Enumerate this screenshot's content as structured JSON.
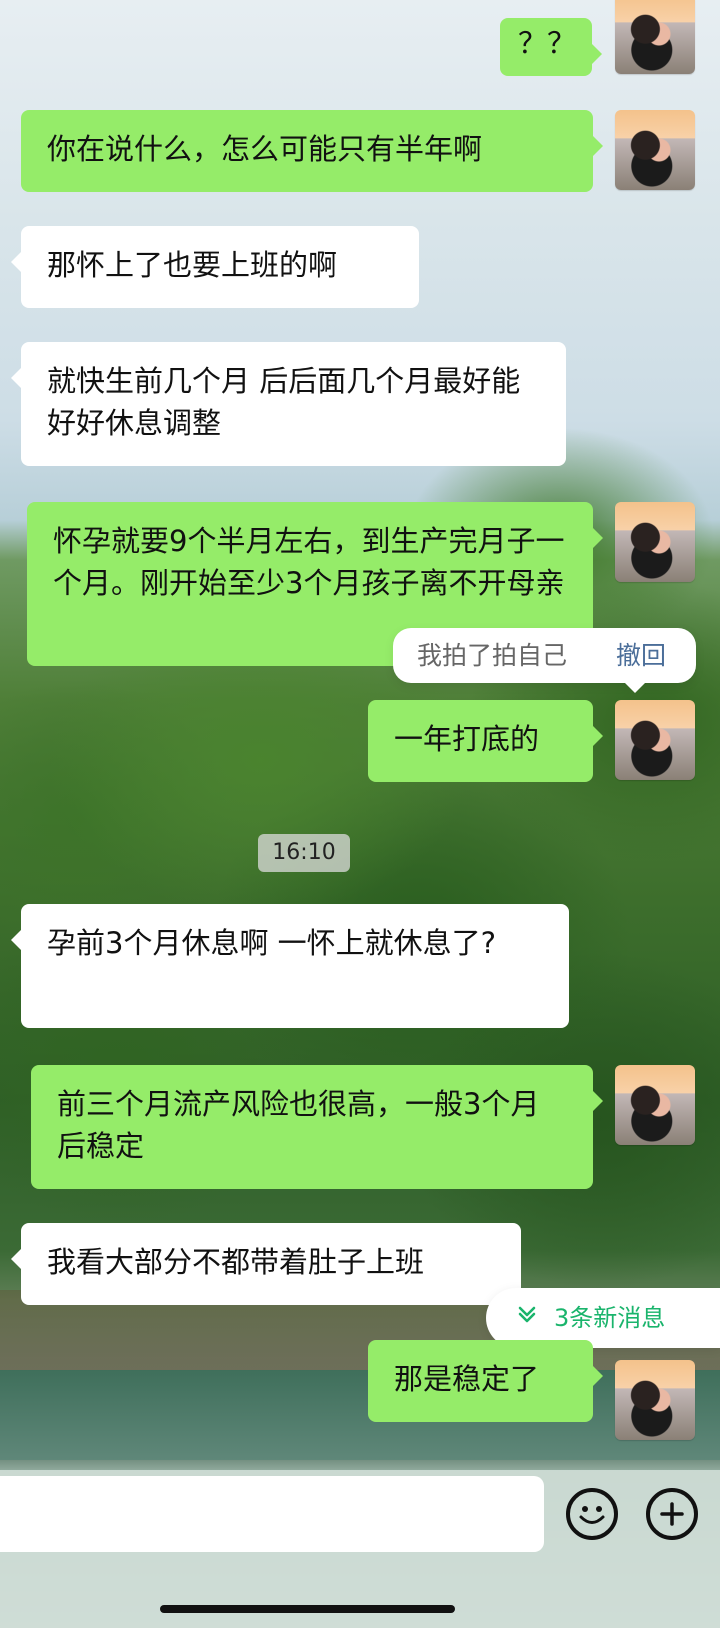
{
  "chat": {
    "time_badge": "16:10",
    "action_menu": {
      "label": "我拍了拍自己",
      "undo": "撤回"
    },
    "new_messages": "3条新消息",
    "messages": [
      {
        "side": "right",
        "text": "？？"
      },
      {
        "side": "right",
        "text": "你在说什么，怎么可能只有半年啊"
      },
      {
        "side": "left",
        "text": "那怀上了也要上班的啊"
      },
      {
        "side": "left",
        "text": "就快生前几个月 后后面几个月最好能好好休息调整"
      },
      {
        "side": "right",
        "text": "怀孕就要9个半月左右，到生产完月子一个月。刚开始至少3个月孩子离不开母亲"
      },
      {
        "side": "right",
        "text": "一年打底的"
      },
      {
        "side": "left",
        "text": "孕前3个月休息啊  一怀上就休息了?"
      },
      {
        "side": "right",
        "text": "前三个月流产风险也很高，一般3个月后稳定"
      },
      {
        "side": "left",
        "text": "我看大部分不都带着肚子上班"
      },
      {
        "side": "right",
        "text": "那是稳定了"
      }
    ]
  },
  "icons": {
    "emoji": "emoji-icon",
    "plus": "plus-icon",
    "chevron": "chevron-down-icon"
  }
}
